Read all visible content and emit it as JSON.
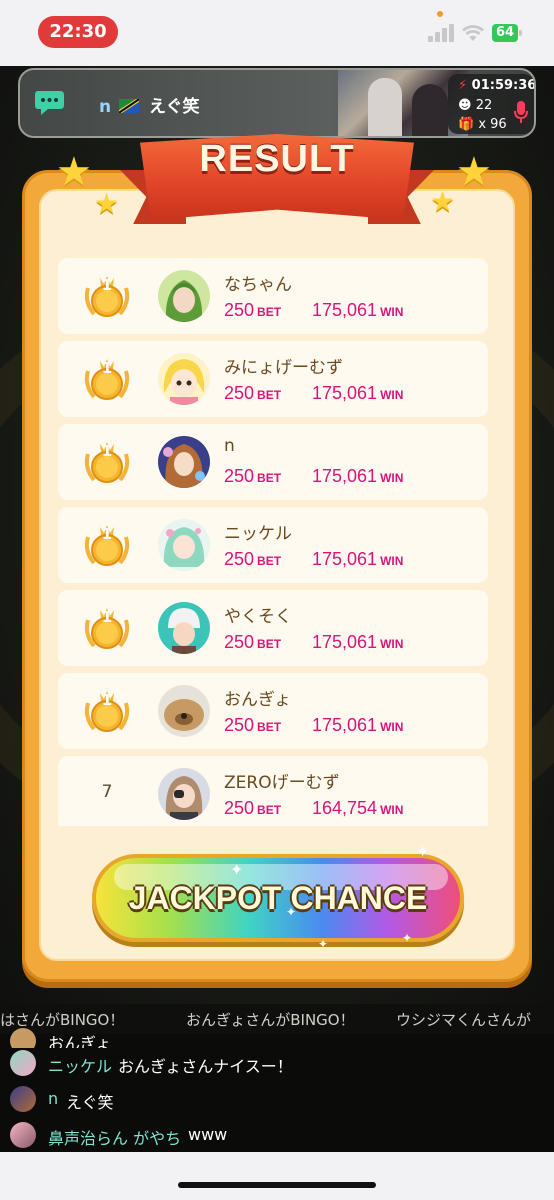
{
  "status_bar": {
    "time": "22:30",
    "battery": "64"
  },
  "stream": {
    "host_prefix": "n",
    "host_name": "えぐ笑",
    "elapsed": "01:59:36",
    "viewers": "22",
    "gifts": "x 96"
  },
  "result": {
    "title": "RESULT",
    "bet_unit": "BET",
    "win_unit": "WIN",
    "rows": [
      {
        "rank": "1",
        "name": "なちゃん",
        "bet": "250",
        "win": "175,061"
      },
      {
        "rank": "1",
        "name": "みにょげーむず",
        "bet": "250",
        "win": "175,061"
      },
      {
        "rank": "1",
        "name": "n",
        "bet": "250",
        "win": "175,061"
      },
      {
        "rank": "1",
        "name": "ニッケル",
        "bet": "250",
        "win": "175,061"
      },
      {
        "rank": "1",
        "name": "やくそく",
        "bet": "250",
        "win": "175,061"
      },
      {
        "rank": "1",
        "name": "おんぎょ",
        "bet": "250",
        "win": "175,061"
      },
      {
        "rank": "7",
        "name": "ZEROげーむず",
        "bet": "250",
        "win": "164,754"
      }
    ]
  },
  "jackpot": {
    "label": "JACKPOT CHANCE"
  },
  "ticker": {
    "items": [
      "はさんがBINGO！",
      "おんぎょさんがBINGO！",
      "ウシジマくんさんが"
    ]
  },
  "chat": {
    "partial_top": "おんぎょ",
    "messages": [
      {
        "user": "ニッケル",
        "text": "おんぎょさんナイスー！"
      },
      {
        "user": "n",
        "text": "えぐ笑"
      },
      {
        "user": "鼻声治らん がやち",
        "text": "www"
      }
    ]
  },
  "colors": {
    "accent_pink": "#d8147a",
    "card_orange": "#f3a93a",
    "ribbon_red": "#e3462a",
    "chat_user": "#7ee3d0",
    "live_red": "#e03a3a"
  },
  "icons": [
    "chat-bubble-icon",
    "flag-icon",
    "bolt-icon",
    "viewer-icon",
    "gift-icon",
    "mic-icon",
    "star-icon",
    "crown-medal-icon",
    "signal-icon",
    "wifi-icon",
    "battery-icon"
  ]
}
